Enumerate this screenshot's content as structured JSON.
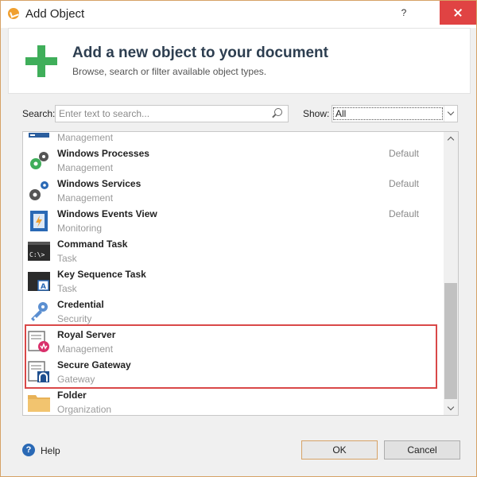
{
  "window": {
    "title": "Add Object",
    "help_glyph": "?",
    "close_glyph": "✕"
  },
  "header": {
    "title": "Add a new object to your document",
    "subtitle": "Browse, search or filter available object types."
  },
  "search": {
    "label": "Search:",
    "placeholder": "Enter text to search...",
    "value": ""
  },
  "show": {
    "label": "Show:",
    "selected": "All"
  },
  "list": {
    "partial_top_category": "Management",
    "items": [
      {
        "name": "Windows Processes",
        "category": "Management",
        "default": "Default",
        "icon": "windows-processes-icon"
      },
      {
        "name": "Windows Services",
        "category": "Management",
        "default": "Default",
        "icon": "windows-services-icon"
      },
      {
        "name": "Windows Events View",
        "category": "Monitoring",
        "default": "Default",
        "icon": "windows-events-icon"
      },
      {
        "name": "Command Task",
        "category": "Task",
        "default": "",
        "icon": "command-task-icon"
      },
      {
        "name": "Key Sequence Task",
        "category": "Task",
        "default": "",
        "icon": "key-sequence-icon"
      },
      {
        "name": "Credential",
        "category": "Security",
        "default": "",
        "icon": "key-icon"
      },
      {
        "name": "Royal Server",
        "category": "Management",
        "default": "",
        "icon": "royal-server-icon"
      },
      {
        "name": "Secure Gateway",
        "category": "Gateway",
        "default": "",
        "icon": "secure-gateway-icon"
      },
      {
        "name": "Folder",
        "category": "Organization",
        "default": "",
        "icon": "folder-icon"
      }
    ]
  },
  "footer": {
    "help_label": "Help",
    "help_icon_glyph": "?",
    "ok_label": "OK",
    "cancel_label": "Cancel"
  },
  "colors": {
    "accent_border": "#d6a266",
    "highlight": "#d94848",
    "plus": "#3fae5a"
  }
}
